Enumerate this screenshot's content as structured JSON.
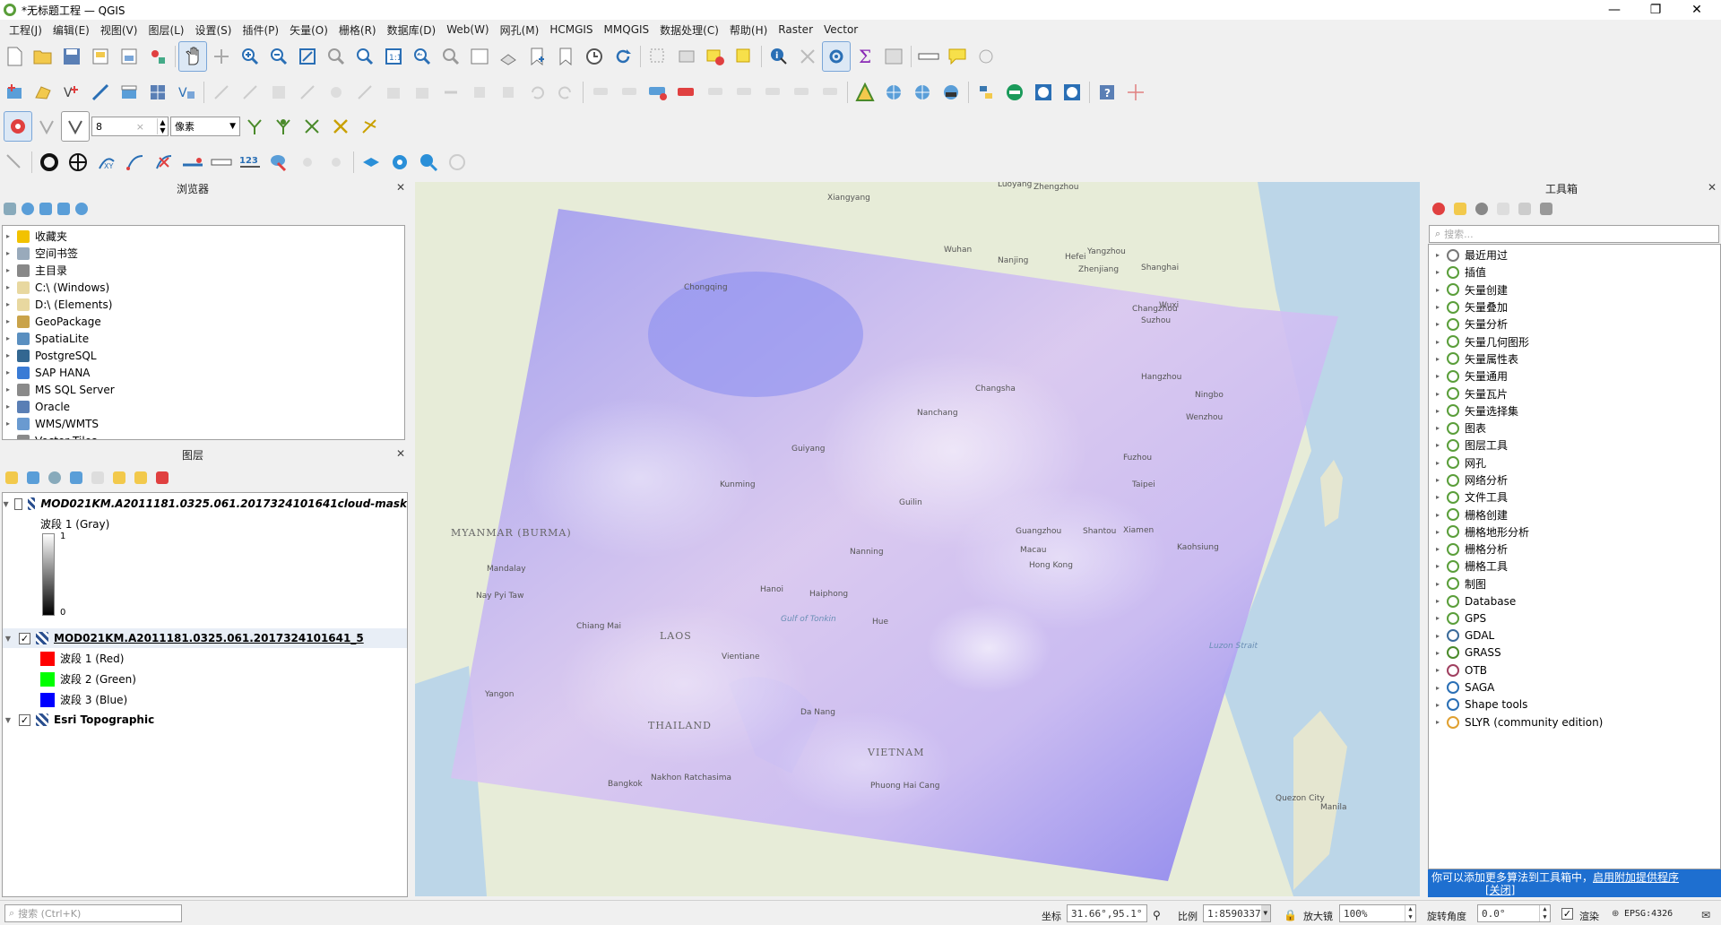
{
  "window": {
    "title": "*无标题工程 — QGIS",
    "min": "—",
    "max": "❐",
    "close": "✕"
  },
  "menu": [
    "工程(J)",
    "编辑(E)",
    "视图(V)",
    "图层(L)",
    "设置(S)",
    "插件(P)",
    "矢量(O)",
    "栅格(R)",
    "数据库(D)",
    "Web(W)",
    "网孔(M)",
    "HCMGIS",
    "MMQGIS",
    "数据处理(C)",
    "帮助(H)",
    "Raster",
    "Vector"
  ],
  "snapping": {
    "tolerance": "8",
    "unit": "像素"
  },
  "browser": {
    "title": "浏览器",
    "items": [
      {
        "label": "收藏夹",
        "icon": "star-icon",
        "color": "#f2c200"
      },
      {
        "label": "空间书签",
        "icon": "bookmark-icon",
        "color": "#9ab"
      },
      {
        "label": "主目录",
        "icon": "home-icon",
        "color": "#888"
      },
      {
        "label": "C:\\ (Windows)",
        "icon": "folder-icon",
        "color": "#e8d8a0"
      },
      {
        "label": "D:\\ (Elements)",
        "icon": "folder-icon",
        "color": "#e8d8a0"
      },
      {
        "label": "GeoPackage",
        "icon": "geopackage-icon",
        "color": "#c9a34a"
      },
      {
        "label": "SpatiaLite",
        "icon": "spatialite-icon",
        "color": "#5a8fc0"
      },
      {
        "label": "PostgreSQL",
        "icon": "postgresql-icon",
        "color": "#336791"
      },
      {
        "label": "SAP HANA",
        "icon": "saphana-icon",
        "color": "#3a7bd5"
      },
      {
        "label": "MS SQL Server",
        "icon": "mssql-icon",
        "color": "#8a8a8a"
      },
      {
        "label": "Oracle",
        "icon": "oracle-icon",
        "color": "#5a7fb5"
      },
      {
        "label": "WMS/WMTS",
        "icon": "wms-icon",
        "color": "#6a9ad0"
      },
      {
        "label": "Vector Tiles",
        "icon": "vectortiles-icon",
        "color": "#8a8a8a"
      }
    ]
  },
  "layers": {
    "title": "图层",
    "items": [
      {
        "name": "MOD021KM.A2011181.0325.061.2017324101641cloud-mask",
        "checked": false,
        "italic": true
      },
      {
        "band_label": "波段 1 (Gray)",
        "ramp_max": "1",
        "ramp_min": "0"
      },
      {
        "name": "MOD021KM.A2011181.0325.061.2017324101641_5",
        "checked": true,
        "underline": true
      },
      {
        "band": "波段 1 (Red)",
        "color": "#ff0000"
      },
      {
        "band": "波段 2 (Green)",
        "color": "#00ff00"
      },
      {
        "band": "波段 3 (Blue)",
        "color": "#0000ff"
      },
      {
        "name": "Esri Topographic",
        "checked": true
      }
    ]
  },
  "toolbox": {
    "title": "工具箱",
    "search_placeholder": "搜索...",
    "items": [
      {
        "label": "最近用过",
        "icon": "clock-icon"
      },
      {
        "label": "插值",
        "icon": "qgis-icon"
      },
      {
        "label": "矢量创建",
        "icon": "qgis-icon"
      },
      {
        "label": "矢量叠加",
        "icon": "qgis-icon"
      },
      {
        "label": "矢量分析",
        "icon": "qgis-icon"
      },
      {
        "label": "矢量几何图形",
        "icon": "qgis-icon"
      },
      {
        "label": "矢量属性表",
        "icon": "qgis-icon"
      },
      {
        "label": "矢量通用",
        "icon": "qgis-icon"
      },
      {
        "label": "矢量瓦片",
        "icon": "qgis-icon"
      },
      {
        "label": "矢量选择集",
        "icon": "qgis-icon"
      },
      {
        "label": "图表",
        "icon": "qgis-icon"
      },
      {
        "label": "图层工具",
        "icon": "qgis-icon"
      },
      {
        "label": "网孔",
        "icon": "qgis-icon"
      },
      {
        "label": "网络分析",
        "icon": "qgis-icon"
      },
      {
        "label": "文件工具",
        "icon": "qgis-icon"
      },
      {
        "label": "栅格创建",
        "icon": "qgis-icon"
      },
      {
        "label": "栅格地形分析",
        "icon": "qgis-icon"
      },
      {
        "label": "栅格分析",
        "icon": "qgis-icon"
      },
      {
        "label": "栅格工具",
        "icon": "qgis-icon"
      },
      {
        "label": "制图",
        "icon": "qgis-icon"
      },
      {
        "label": "Database",
        "icon": "qgis-icon"
      },
      {
        "label": "GPS",
        "icon": "qgis-icon"
      },
      {
        "label": "GDAL",
        "icon": "gdal-icon"
      },
      {
        "label": "GRASS",
        "icon": "grass-icon"
      },
      {
        "label": "OTB",
        "icon": "otb-icon"
      },
      {
        "label": "SAGA",
        "icon": "saga-icon"
      },
      {
        "label": "Shape tools",
        "icon": "star-icon"
      },
      {
        "label": "SLYR (community edition)",
        "icon": "slyr-icon"
      }
    ],
    "notice": "你可以添加更多算法到工具箱中，",
    "notice_link": "启用附加提供程序",
    "notice_close": "[关闭]"
  },
  "map_labels": [
    "Luoyang",
    "Zhengzhou",
    "Xiangyang",
    "Wuhan",
    "Nanjing",
    "Hefei",
    "Shanghai",
    "Chongqing",
    "Changsha",
    "Nanchang",
    "Kunming",
    "Guiyang",
    "Guilin",
    "Fuzhou",
    "Taipei",
    "Guangzhou",
    "Shantou",
    "Hong Kong",
    "Macau",
    "Nanning",
    "Hanoi",
    "Haiphong",
    "Vientiane",
    "Yangon",
    "Bangkok",
    "Da Nang",
    "MYANMAR\n(BURMA)",
    "LAOS",
    "THAILAND",
    "VIETNAM",
    "Gulf of Tonkin",
    "Luzon Strait",
    "Manila",
    "Quezon City",
    "Kaohsiung",
    "Xiamen",
    "Wenzhou",
    "Ningbo",
    "Hangzhou",
    "Suzhou",
    "Wuxi",
    "Changzhou",
    "Zhenjiang",
    "Yangzhou",
    "Mandalay",
    "Nay Pyi Taw",
    "Chiang Mai",
    "Nakhon Ratchasima",
    "Phuong Hai Cang",
    "Hue"
  ],
  "status": {
    "search_placeholder": "搜索 (Ctrl+K)",
    "coord_label": "坐标",
    "coord": "31.66°,95.1°",
    "scale_label": "比例",
    "scale": "1:8590337",
    "magnifier_label": "放大镜",
    "magnifier": "100%",
    "rotation_label": "旋转角度",
    "rotation": "0.0°",
    "render_label": "渲染",
    "crs": "EPSG:4326"
  }
}
